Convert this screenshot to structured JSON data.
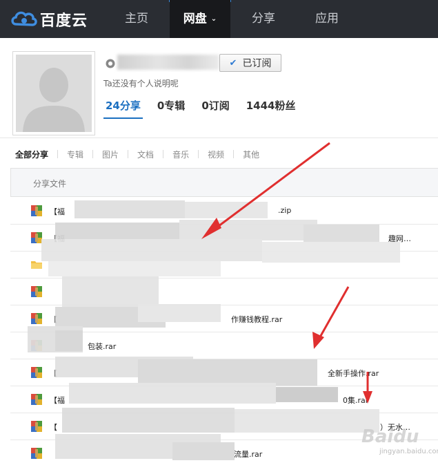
{
  "app": {
    "logo_text": "百度云"
  },
  "nav": {
    "items": [
      {
        "label": "主页"
      },
      {
        "label": "网盘"
      },
      {
        "label": "分享"
      },
      {
        "label": "应用"
      }
    ],
    "caret": "⌄"
  },
  "profile": {
    "subscribe_label": "已订阅",
    "subscribe_check": "✔",
    "bio": "Ta还没有个人说明呢",
    "stats": [
      {
        "label": "24分享"
      },
      {
        "label": "0专辑"
      },
      {
        "label": "0订阅"
      },
      {
        "label": "1444粉丝"
      }
    ]
  },
  "categories": [
    "全部分享",
    "专辑",
    "图片",
    "文档",
    "音乐",
    "视频",
    "其他"
  ],
  "table": {
    "header": "分享文件",
    "rows": [
      {
        "icon": "rar-icon",
        "name_visible": "【福",
        "ext": ".zip"
      },
      {
        "icon": "rar-icon",
        "name_visible": "【福",
        "ext": "趣网…"
      },
      {
        "icon": "folder-icon",
        "name_visible": "",
        "ext": ""
      },
      {
        "icon": "rar-icon",
        "name_visible": "",
        "ext": ""
      },
      {
        "icon": "rar-icon",
        "name_visible": "【",
        "ext": "作赚钱教程.rar"
      },
      {
        "icon": "rar-icon",
        "name_visible": "",
        "ext": "包装.rar"
      },
      {
        "icon": "rar-icon",
        "name_visible": "【",
        "ext": "全新手操作.rar"
      },
      {
        "icon": "rar-icon",
        "name_visible": "【福",
        "ext": "0集.rar"
      },
      {
        "icon": "rar-icon",
        "name_visible": "【",
        "ext": "）无水…"
      },
      {
        "icon": "rar-icon",
        "name_visible": "",
        "ext": "流量.rar"
      }
    ]
  },
  "watermark": {
    "text": "Baidu",
    "sub": "jingyan.baidu.com"
  },
  "colors": {
    "topbar": "#2a2d33",
    "accent": "#1b6fc0",
    "arrow": "#e02f2f"
  }
}
